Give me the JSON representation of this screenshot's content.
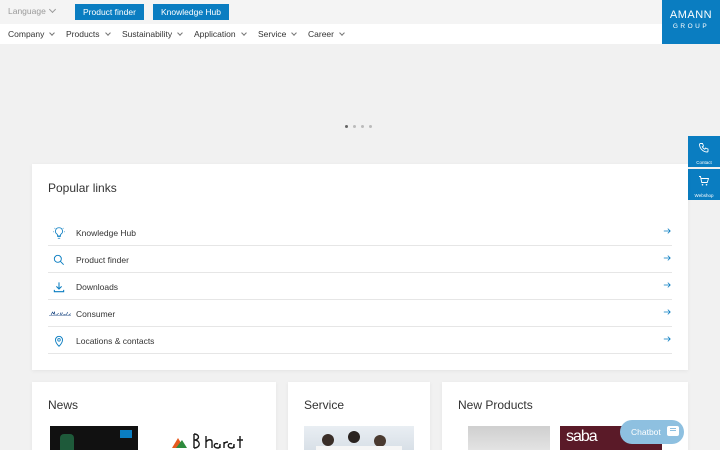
{
  "header": {
    "language_label": "Language",
    "product_finder": "Product finder",
    "knowledge_hub": "Knowledge Hub",
    "logo_line1": "AMANN",
    "logo_line2": "GROUP"
  },
  "nav": {
    "items": [
      {
        "label": "Company"
      },
      {
        "label": "Products"
      },
      {
        "label": "Sustainability"
      },
      {
        "label": "Application"
      },
      {
        "label": "Service"
      },
      {
        "label": "Career"
      }
    ]
  },
  "carousel": {
    "slides": 4,
    "active": 0
  },
  "side": {
    "contact": "Contact",
    "webshop": "Webshop"
  },
  "popular": {
    "title": "Popular links",
    "links": [
      {
        "label": "Knowledge Hub",
        "icon": "lightbulb-icon"
      },
      {
        "label": "Product finder",
        "icon": "search-icon"
      },
      {
        "label": "Downloads",
        "icon": "download-icon"
      },
      {
        "label": "Consumer",
        "icon": "mettler-logo-icon"
      },
      {
        "label": "Locations & contacts",
        "icon": "location-pin-icon"
      }
    ]
  },
  "sections": {
    "news": "News",
    "service": "Service",
    "new_products": "New Products"
  },
  "chatbot": {
    "label": "Chatbot"
  },
  "colors": {
    "brand_blue": "#0a7dc1"
  }
}
